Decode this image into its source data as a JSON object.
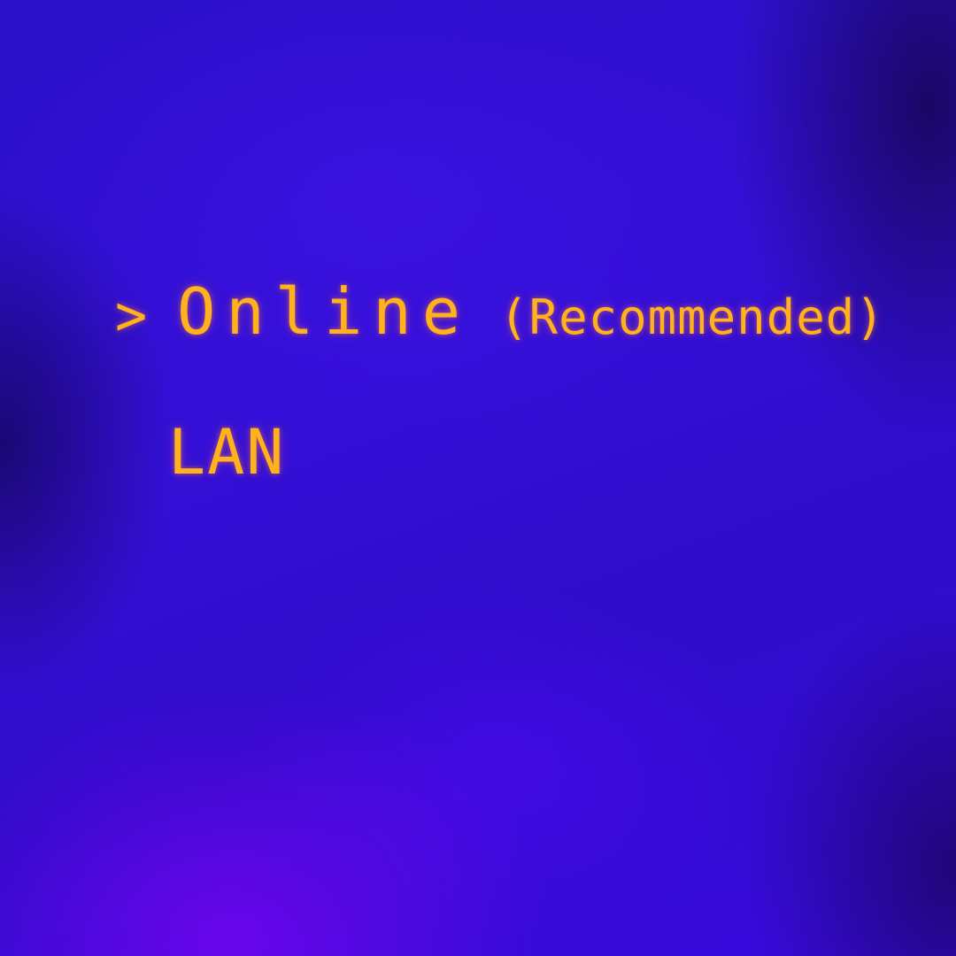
{
  "menu": {
    "cursor": ">",
    "items": [
      {
        "label": "Online",
        "note": "(Recommended)",
        "selected": true
      },
      {
        "label": "LAN",
        "note": "",
        "selected": false
      }
    ]
  },
  "colors": {
    "text": "#ffb21e",
    "background": "#2d0cc9"
  }
}
